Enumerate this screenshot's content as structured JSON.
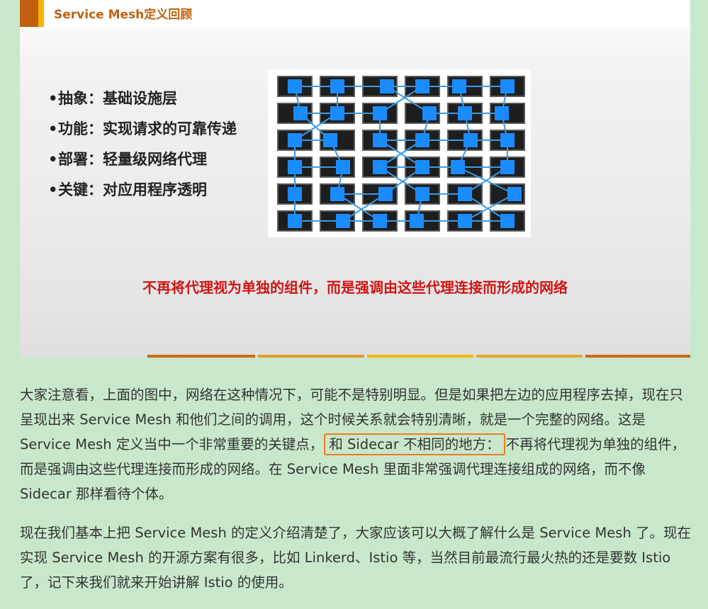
{
  "slide": {
    "title": "Service Mesh定义回顾",
    "bullets": [
      {
        "dot": "•",
        "text": "抽象：基础设施层"
      },
      {
        "dot": "•",
        "text": "功能：实现请求的可靠传递"
      },
      {
        "dot": "•",
        "text": "部署：轻量级网络代理"
      },
      {
        "dot": "•",
        "text": "关键：对应用程序透明"
      }
    ],
    "tagline": "不再将代理视为单独的组件，而是强调由这些代理连接而形成的网络",
    "colors": {
      "accent_dark": "#c15f0c",
      "accent_gold": "#f6b400",
      "title": "#c0620e",
      "tagline": "#d11414",
      "node_blue": "#1a8cff",
      "app_box": "#1e1e1e",
      "link_line": "#3a9ae6"
    }
  },
  "article": {
    "p1_before": "大家注意看，上面的图中，网络在这种情况下，可能不是特别明显。但是如果把左边的应用程序去掉，现在只呈现出来 Service Mesh 和他们之间的调用，这个时候关系就会特别清晰，就是一个完整的网络。这是 Service Mesh 定义当中一个非常重要的关键点，",
    "p1_highlight": "和 Sidecar 不相同的地方：",
    "p1_after": "不再将代理视为单独的组件，而是强调由这些代理连接而形成的网络。在 Service Mesh 里面非常强调代理连接组成的网络，而不像 Sidecar 那样看待个体。",
    "p2": "现在我们基本上把 Service Mesh 的定义介绍清楚了，大家应该可以大概了解什么是 Service Mesh 了。现在实现 Service Mesh 的开源方案有很多，比如 Linkerd、Istio 等，当然目前最流行最火热的还是要数 Istio 了，记下来我们就来开始讲解 Istio 的使用。",
    "highlight_color": "#f07a1c"
  }
}
